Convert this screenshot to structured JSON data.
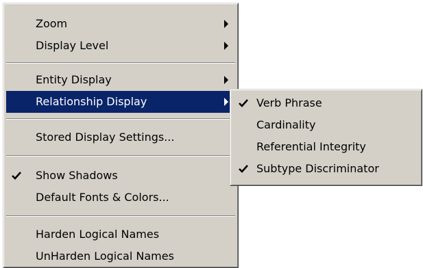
{
  "main_menu": {
    "items": [
      {
        "label": "Zoom"
      },
      {
        "label": "Display Level"
      },
      {
        "label": "Entity Display"
      },
      {
        "label": "Relationship Display"
      },
      {
        "label": "Stored Display Settings..."
      },
      {
        "label": "Show Shadows",
        "checked": true
      },
      {
        "label": "Default Fonts & Colors..."
      },
      {
        "label": "Harden Logical Names"
      },
      {
        "label": "UnHarden Logical Names"
      }
    ]
  },
  "sub_menu": {
    "items": [
      {
        "label": "Verb Phrase",
        "checked": true
      },
      {
        "label": "Cardinality",
        "checked": false
      },
      {
        "label": "Referential Integrity",
        "checked": false
      },
      {
        "label": "Subtype Discriminator",
        "checked": true
      }
    ]
  },
  "colors": {
    "menu_face": "#d4d0c8",
    "highlight": "#0a246a",
    "highlight_text": "#ffffff"
  },
  "icons": {
    "check": "check-icon",
    "submenu_arrow": "submenu-arrow-icon"
  }
}
